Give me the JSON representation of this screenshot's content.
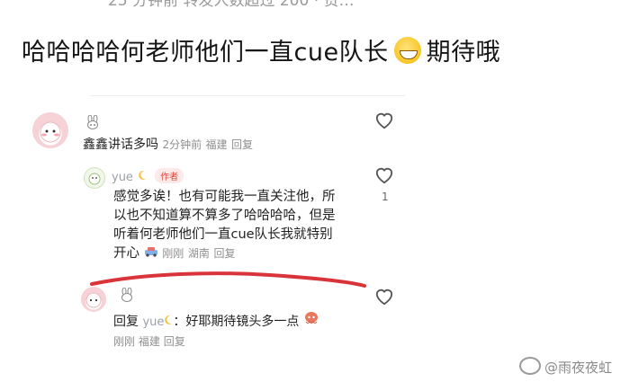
{
  "top_partial": "25 分钟前  转发人数超过 200 · 赞…",
  "post": {
    "text_before": "哈哈哈哈何老师他们一直cue队长",
    "text_after": "期待哦"
  },
  "comment": {
    "name": "鑫鑫讲话多吗",
    "time": "2分钟前",
    "location": "福建",
    "reply_label": "回复"
  },
  "reply": {
    "username": "yue",
    "author_badge": "作者",
    "lines": [
      "感觉多诶！也有可能我一直关注他，所",
      "以也不知道算不算多了哈哈哈哈，但是",
      "听着何老师他们一直cue队长我就特别",
      "开心"
    ],
    "time": "刚刚",
    "location": "湖南",
    "reply_label": "回复",
    "like_count": "1"
  },
  "reply2": {
    "prefix": "回复",
    "target": "yue",
    "content": "：好耶期待镜头多一点",
    "time": "刚刚",
    "location": "福建",
    "reply_label": "回复"
  },
  "watermark": "@雨夜夜虹",
  "icons": {
    "like": "heart-outline-icon",
    "moon": "crescent-moon-icon",
    "bunny": "bunny-emoji-icon"
  },
  "colors": {
    "underline": "#d8343a",
    "author_badge": "#e0453c"
  }
}
